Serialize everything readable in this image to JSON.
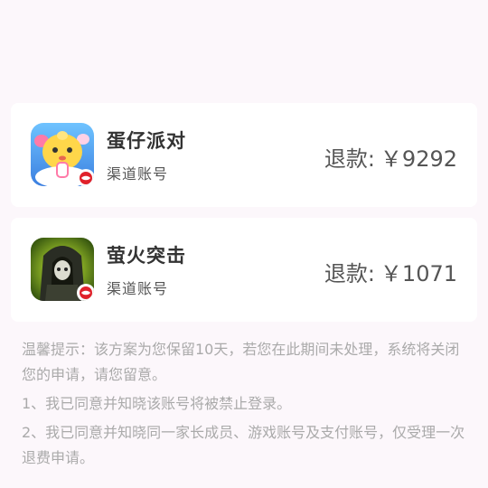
{
  "colors": {
    "page_background": "#fcf7fb",
    "card_background": "#ffffff",
    "primary_text": "#333333",
    "secondary_text": "#555555",
    "note_text": "#aaaaaa"
  },
  "games": [
    {
      "name": "蛋仔派对",
      "account_type": "渠道账号",
      "refund_label": "退款:",
      "refund_amount": "￥9292",
      "icon": "egg-party-icon"
    },
    {
      "name": "萤火突击",
      "account_type": "渠道账号",
      "refund_label": "退款:",
      "refund_amount": "￥1071",
      "icon": "firefly-strike-icon"
    }
  ],
  "notes": {
    "reminder": "温馨提示：该方案为您保留10天，若您在此期间未处理，系统将关闭您的申请，请您留意。",
    "item_1": "1、我已同意并知晓该账号将被禁止登录。",
    "item_2": "2、我已同意并知晓同一家长成员、游戏账号及支付账号，仅受理一次退费申请。"
  }
}
